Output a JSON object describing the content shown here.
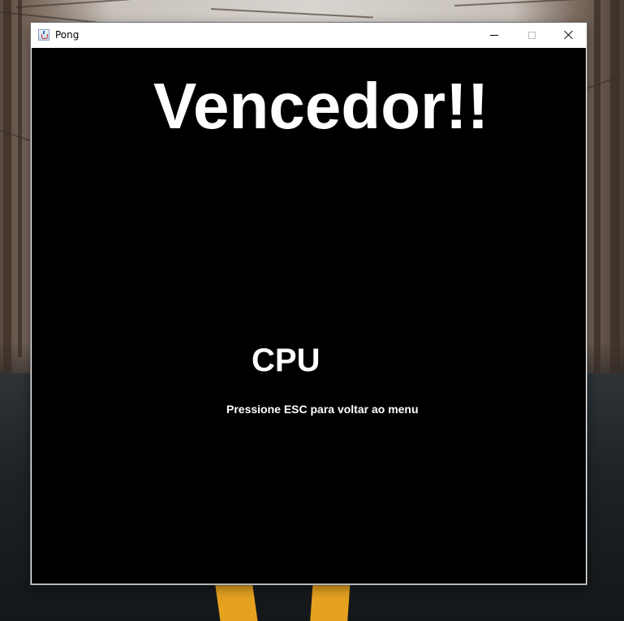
{
  "window": {
    "title": "Pong",
    "icon": "java-app-icon"
  },
  "controls": {
    "minimize_icon": "minimize-icon",
    "maximize_icon": "maximize-icon",
    "close_icon": "close-icon"
  },
  "game": {
    "heading": "Vencedor!!",
    "winner": "CPU",
    "hint": "Pressione ESC para voltar ao menu"
  },
  "colors": {
    "canvas_background": "#000000",
    "text": "#ffffff",
    "road_line": "#e5a221"
  }
}
